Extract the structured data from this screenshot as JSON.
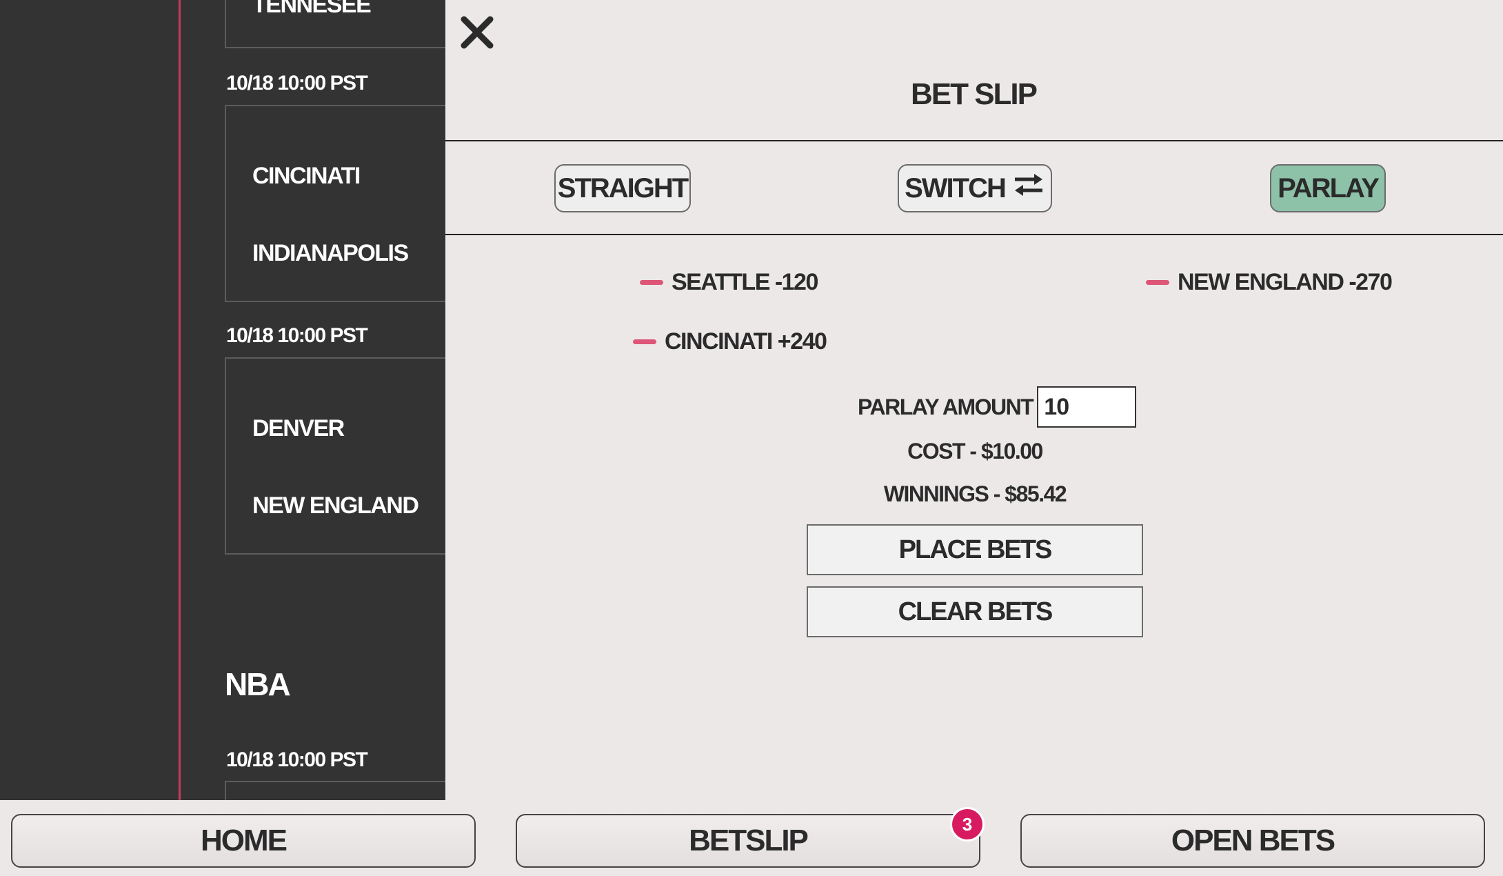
{
  "sidebar": {
    "partial_team": "TENNESEE",
    "games": [
      {
        "date": "10/18 10:00 PST",
        "teams": [
          "CINCINATI",
          "INDIANAPOLIS"
        ]
      },
      {
        "date": "10/18 10:00 PST",
        "teams": [
          "DENVER",
          "NEW ENGLAND"
        ]
      }
    ],
    "league_title": "NBA",
    "nba_game_date": "10/18 10:00 PST"
  },
  "betslip": {
    "title": "BET SLIP",
    "modes": {
      "straight": "STRAIGHT",
      "switch": "SWITCH",
      "parlay": "PARLAY",
      "active": "parlay"
    },
    "bets": [
      "SEATTLE -120",
      "NEW ENGLAND -270",
      "CINCINATI +240"
    ],
    "parlay_amount_label": "PARLAY AMOUNT",
    "parlay_amount_value": "10",
    "cost": "COST - $10.00",
    "winnings": "WINNINGS - $85.42",
    "place_bets": "PLACE BETS",
    "clear_bets": "CLEAR BETS"
  },
  "nav": {
    "home": "HOME",
    "betslip": "BETSLIP",
    "betslip_count": "3",
    "open_bets": "OPEN BETS"
  },
  "colors": {
    "accent": "#c73a63",
    "parlay_active": "#8ec2a8",
    "remove_dash": "#dd5577",
    "badge": "#d81b60"
  }
}
